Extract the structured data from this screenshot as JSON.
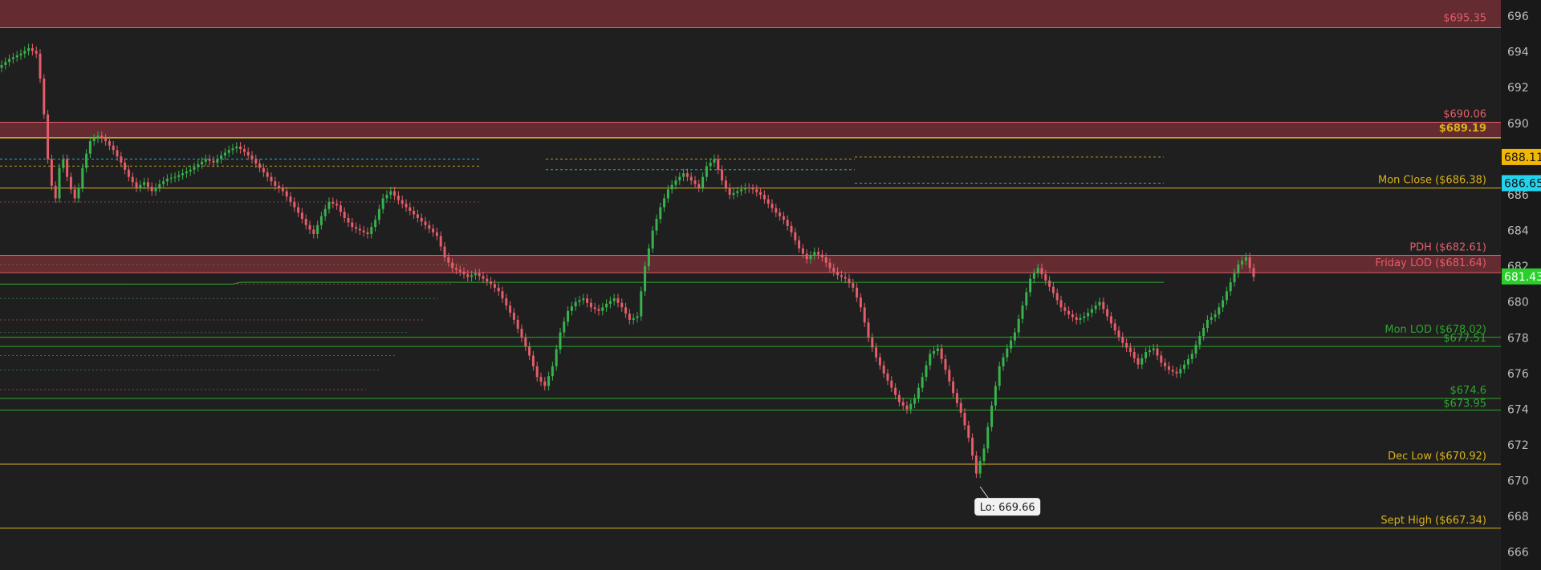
{
  "colors": {
    "background": "#1f1f1f",
    "axis_bg": "#191919",
    "up": "#37b24d",
    "down": "#e35d6a",
    "zone": "#6b2c33",
    "zone_border": "#e35d6a",
    "yellow": "#d8b21c",
    "green": "#2fa52f",
    "cyan": "#22d3ee",
    "last_price_bg": "#2bcf2b",
    "marker_yellow_bg": "#f2b705"
  },
  "chart_data": {
    "type": "line",
    "description_style": "candlestick price chart",
    "ylim": [
      665.0,
      696.9
    ],
    "y_ticks": [
      "696",
      "694",
      "692",
      "690",
      "688",
      "686",
      "684",
      "682",
      "680",
      "678",
      "676",
      "674",
      "672",
      "670",
      "668",
      "666"
    ],
    "y_tick_values": [
      696,
      694,
      692,
      690,
      688,
      686,
      684,
      682,
      680,
      678,
      676,
      674,
      672,
      670,
      668,
      666
    ],
    "zones": [
      {
        "from": 695.35,
        "to": 697.0,
        "label": "$695.35"
      },
      {
        "from": 689.19,
        "to": 690.06
      },
      {
        "from": 681.64,
        "to": 682.61
      }
    ],
    "levels": [
      {
        "value": 695.35,
        "label": "$695.35",
        "color": "red"
      },
      {
        "value": 690.06,
        "label": "$690.06",
        "color": "red"
      },
      {
        "value": 689.19,
        "label": "$689.19",
        "color": "yellow",
        "bold": true
      },
      {
        "value": 686.38,
        "label": "Mon Close ($686.38)",
        "color": "yellow"
      },
      {
        "value": 682.61,
        "label": "PDH ($682.61)",
        "color": "red"
      },
      {
        "value": 681.64,
        "label": "Friday LOD ($681.64)",
        "color": "red"
      },
      {
        "value": 678.02,
        "label": "Mon LOD ($678.02)",
        "color": "green"
      },
      {
        "value": 677.51,
        "label": "$677.51",
        "color": "green"
      },
      {
        "value": 674.6,
        "label": "$674.6",
        "color": "green"
      },
      {
        "value": 673.95,
        "label": "$673.95",
        "color": "green"
      },
      {
        "value": 670.92,
        "label": "Dec Low ($670.92)",
        "color": "yellow"
      },
      {
        "value": 667.34,
        "label": "Sept High  ($667.34)",
        "color": "yellow"
      }
    ],
    "axis_markers": [
      {
        "value": 688.11,
        "label": "688.11",
        "kind": "yellow"
      },
      {
        "value": 686.65,
        "label": "686.65",
        "kind": "cyan"
      },
      {
        "value": 681.43,
        "label": "681.43",
        "kind": "last"
      }
    ],
    "low_callout": {
      "value": 669.66,
      "label": "Lo: 669.66"
    },
    "price_path": [
      [
        0,
        693.1
      ],
      [
        3,
        693.6
      ],
      [
        6,
        693.9
      ],
      [
        8,
        694.2
      ],
      [
        10,
        693.9
      ],
      [
        11,
        692.5
      ],
      [
        12,
        690.5
      ],
      [
        13,
        688.0
      ],
      [
        14,
        686.5
      ],
      [
        15,
        685.8
      ],
      [
        16,
        687.5
      ],
      [
        17,
        688.0
      ],
      [
        18,
        687.0
      ],
      [
        19,
        686.3
      ],
      [
        20,
        685.8
      ],
      [
        21,
        686.4
      ],
      [
        22,
        687.5
      ],
      [
        23,
        688.3
      ],
      [
        24,
        689.0
      ],
      [
        26,
        689.3
      ],
      [
        28,
        689.0
      ],
      [
        30,
        688.5
      ],
      [
        32,
        687.8
      ],
      [
        34,
        687.0
      ],
      [
        36,
        686.4
      ],
      [
        38,
        686.7
      ],
      [
        40,
        686.2
      ],
      [
        42,
        686.6
      ],
      [
        44,
        686.9
      ],
      [
        46,
        687.0
      ],
      [
        48,
        687.2
      ],
      [
        50,
        687.4
      ],
      [
        52,
        687.7
      ],
      [
        54,
        688.0
      ],
      [
        56,
        687.8
      ],
      [
        58,
        688.2
      ],
      [
        60,
        688.5
      ],
      [
        62,
        688.7
      ],
      [
        64,
        688.4
      ],
      [
        66,
        688.0
      ],
      [
        68,
        687.5
      ],
      [
        70,
        687.0
      ],
      [
        72,
        686.5
      ],
      [
        74,
        686.2
      ],
      [
        76,
        685.6
      ],
      [
        78,
        685.0
      ],
      [
        80,
        684.3
      ],
      [
        82,
        683.8
      ],
      [
        84,
        684.8
      ],
      [
        86,
        685.6
      ],
      [
        88,
        685.4
      ],
      [
        90,
        684.7
      ],
      [
        92,
        684.2
      ],
      [
        94,
        684.0
      ],
      [
        96,
        683.8
      ],
      [
        98,
        684.6
      ],
      [
        100,
        685.8
      ],
      [
        102,
        686.2
      ],
      [
        104,
        685.7
      ],
      [
        106,
        685.3
      ],
      [
        108,
        684.9
      ],
      [
        110,
        684.5
      ],
      [
        112,
        684.1
      ],
      [
        114,
        683.7
      ],
      [
        116,
        682.5
      ],
      [
        118,
        681.9
      ],
      [
        120,
        681.7
      ],
      [
        122,
        681.4
      ],
      [
        124,
        681.6
      ],
      [
        126,
        681.3
      ],
      [
        128,
        681.0
      ],
      [
        130,
        680.6
      ],
      [
        132,
        679.8
      ],
      [
        134,
        679.0
      ],
      [
        136,
        678.0
      ],
      [
        138,
        677.0
      ],
      [
        140,
        675.8
      ],
      [
        142,
        675.3
      ],
      [
        144,
        676.4
      ],
      [
        146,
        678.3
      ],
      [
        148,
        679.5
      ],
      [
        150,
        680.0
      ],
      [
        152,
        680.2
      ],
      [
        154,
        679.7
      ],
      [
        156,
        679.5
      ],
      [
        158,
        679.9
      ],
      [
        160,
        680.2
      ],
      [
        162,
        679.7
      ],
      [
        164,
        679.0
      ],
      [
        166,
        679.2
      ],
      [
        168,
        682.0
      ],
      [
        170,
        684.0
      ],
      [
        172,
        685.3
      ],
      [
        174,
        686.3
      ],
      [
        176,
        686.8
      ],
      [
        178,
        687.2
      ],
      [
        180,
        686.8
      ],
      [
        182,
        686.4
      ],
      [
        184,
        687.6
      ],
      [
        186,
        688.0
      ],
      [
        188,
        686.8
      ],
      [
        190,
        686.0
      ],
      [
        192,
        686.2
      ],
      [
        194,
        686.4
      ],
      [
        196,
        686.3
      ],
      [
        198,
        686.0
      ],
      [
        200,
        685.5
      ],
      [
        202,
        685.0
      ],
      [
        204,
        684.6
      ],
      [
        206,
        683.9
      ],
      [
        208,
        683.0
      ],
      [
        210,
        682.4
      ],
      [
        212,
        682.8
      ],
      [
        214,
        682.5
      ],
      [
        216,
        681.9
      ],
      [
        218,
        681.5
      ],
      [
        220,
        681.3
      ],
      [
        222,
        680.8
      ],
      [
        224,
        679.7
      ],
      [
        226,
        678.0
      ],
      [
        228,
        676.9
      ],
      [
        230,
        676.0
      ],
      [
        232,
        675.2
      ],
      [
        234,
        674.4
      ],
      [
        236,
        674.0
      ],
      [
        238,
        674.6
      ],
      [
        240,
        675.8
      ],
      [
        242,
        677.1
      ],
      [
        244,
        677.4
      ],
      [
        246,
        676.2
      ],
      [
        248,
        674.9
      ],
      [
        250,
        673.8
      ],
      [
        252,
        672.4
      ],
      [
        254,
        670.4
      ],
      [
        256,
        671.8
      ],
      [
        258,
        674.2
      ],
      [
        260,
        676.4
      ],
      [
        262,
        677.4
      ],
      [
        264,
        678.3
      ],
      [
        266,
        679.8
      ],
      [
        268,
        681.3
      ],
      [
        270,
        681.9
      ],
      [
        272,
        681.2
      ],
      [
        274,
        680.5
      ],
      [
        276,
        679.7
      ],
      [
        278,
        679.3
      ],
      [
        280,
        679.0
      ],
      [
        282,
        679.2
      ],
      [
        284,
        679.6
      ],
      [
        286,
        680.0
      ],
      [
        288,
        679.2
      ],
      [
        290,
        678.4
      ],
      [
        292,
        677.7
      ],
      [
        294,
        677.2
      ],
      [
        296,
        676.5
      ],
      [
        298,
        677.2
      ],
      [
        300,
        677.4
      ],
      [
        302,
        676.6
      ],
      [
        304,
        676.2
      ],
      [
        306,
        676.0
      ],
      [
        308,
        676.5
      ],
      [
        310,
        677.1
      ],
      [
        312,
        678.1
      ],
      [
        314,
        679.0
      ],
      [
        316,
        679.3
      ],
      [
        318,
        680.1
      ],
      [
        320,
        681.1
      ],
      [
        322,
        682.1
      ],
      [
        324,
        682.5
      ],
      [
        325,
        681.9
      ],
      [
        326,
        681.4
      ]
    ]
  }
}
